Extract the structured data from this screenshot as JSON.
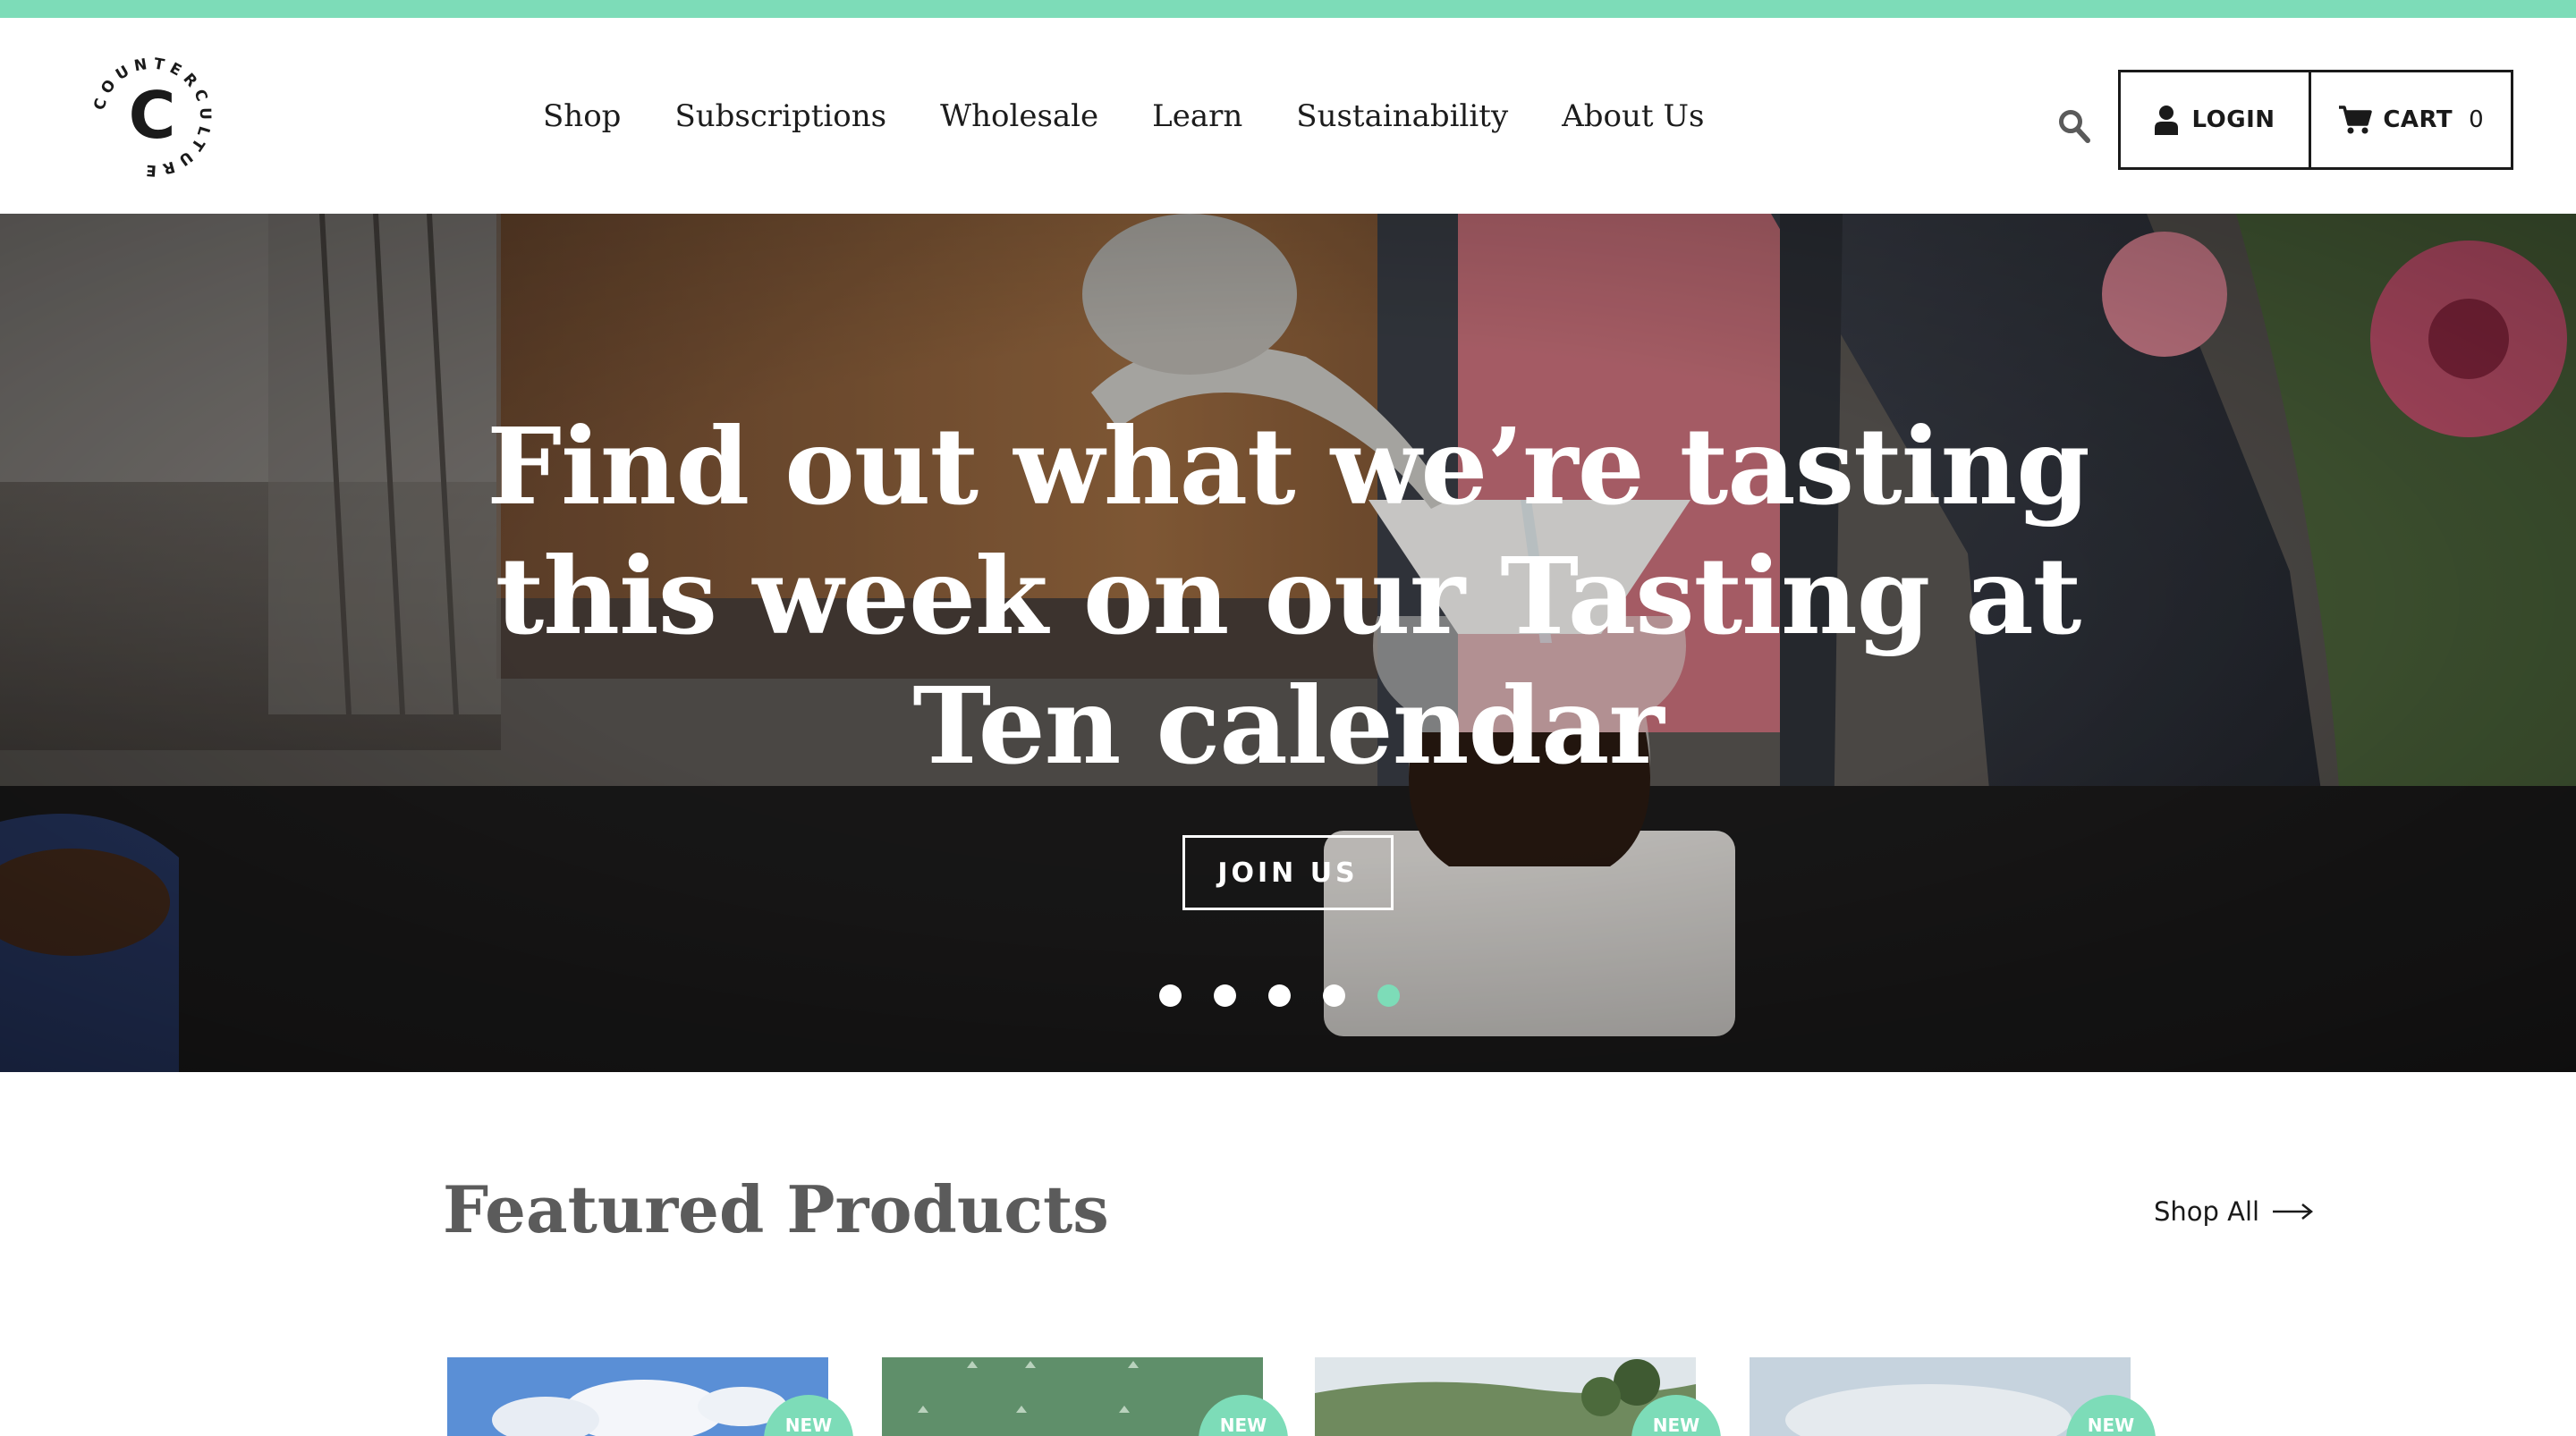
{
  "colors": {
    "accent": "#7ddcb8",
    "dark": "#1a1a1a",
    "muted_heading": "#5b5b5b"
  },
  "brand": {
    "logo_ring_text": "COUNTERCULTURE",
    "logo_letter": "C"
  },
  "nav": {
    "items": [
      "Shop",
      "Subscriptions",
      "Wholesale",
      "Learn",
      "Sustainability",
      "About Us"
    ]
  },
  "header": {
    "search_icon": "search-icon",
    "login_label": "LOGIN",
    "cart_label": "CART",
    "cart_count": "0"
  },
  "hero": {
    "title": "Find out what we’re tasting this week on our Tasting at Ten calendar",
    "button_label": "JOIN US",
    "slides_total": 5,
    "active_slide": 5
  },
  "featured": {
    "title": "Featured Products",
    "shop_all_label": "Shop All"
  },
  "products": [
    {
      "badge": "NEW",
      "image": "sky-clouds"
    },
    {
      "badge": "NEW",
      "image": "green-pattern"
    },
    {
      "badge": "NEW",
      "image": "hillside-trees"
    },
    {
      "badge": "NEW",
      "image": "sky-haze"
    }
  ]
}
